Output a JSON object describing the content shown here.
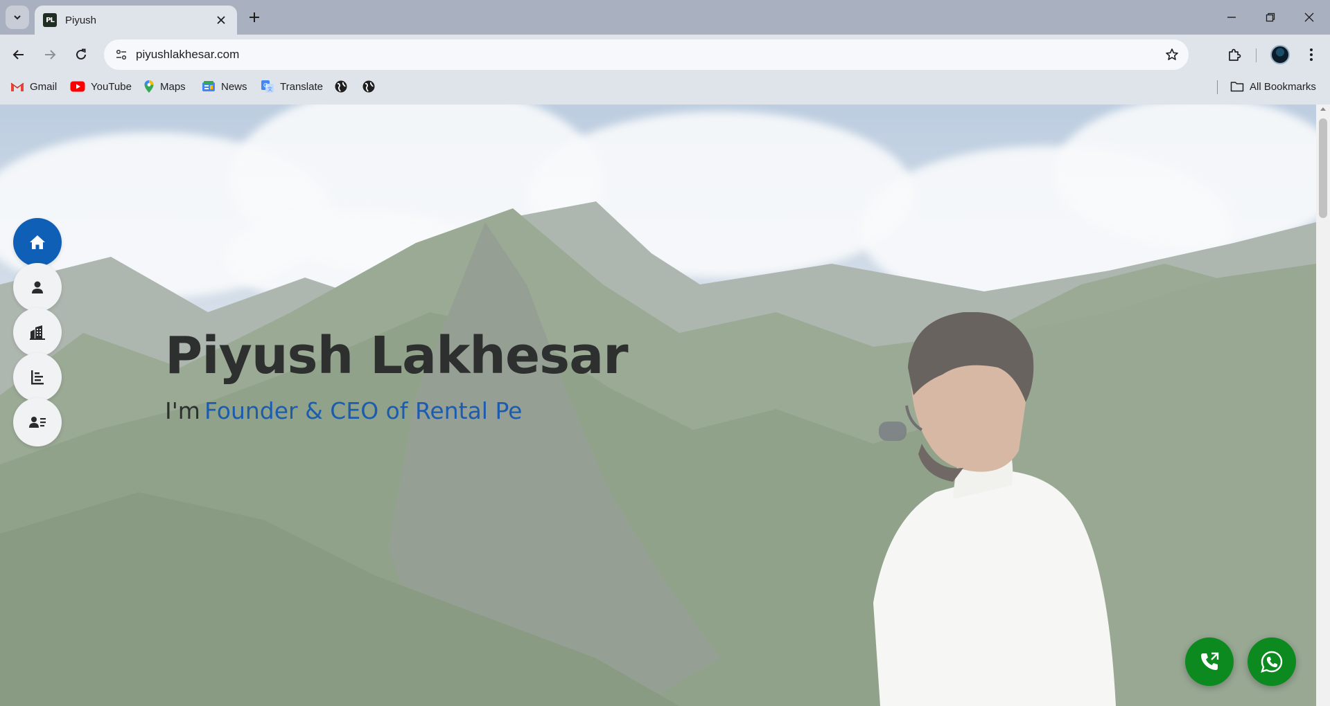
{
  "browser": {
    "tab": {
      "title": "Piyush",
      "favicon_text": "PL"
    },
    "url": "piyushlakhesar.com",
    "bookmarks": [
      {
        "label": "Gmail",
        "icon": "gmail-icon"
      },
      {
        "label": "YouTube",
        "icon": "youtube-icon"
      },
      {
        "label": "Maps",
        "icon": "maps-icon"
      },
      {
        "label": "News",
        "icon": "news-icon"
      },
      {
        "label": "Translate",
        "icon": "translate-icon"
      }
    ],
    "all_bookmarks_label": "All Bookmarks"
  },
  "hero": {
    "name": "Piyush Lakhesar",
    "subtitle_prefix": "I'm",
    "subtitle_typed": "Founder & CEO of Rental Pe"
  },
  "side_nav": [
    {
      "icon": "home-icon",
      "active": true
    },
    {
      "icon": "user-icon",
      "active": false
    },
    {
      "icon": "building-icon",
      "active": false
    },
    {
      "icon": "timeline-icon",
      "active": false
    },
    {
      "icon": "contact-card-icon",
      "active": false
    }
  ],
  "floating": [
    {
      "icon": "phone-call-icon"
    },
    {
      "icon": "whatsapp-icon"
    }
  ],
  "colors": {
    "accent": "#0f5fb7",
    "typed_text": "#1c5cae",
    "fab_green": "#0d8a1f",
    "tabstrip": "#a9b0bf",
    "toolbar": "#dfe3ea"
  }
}
